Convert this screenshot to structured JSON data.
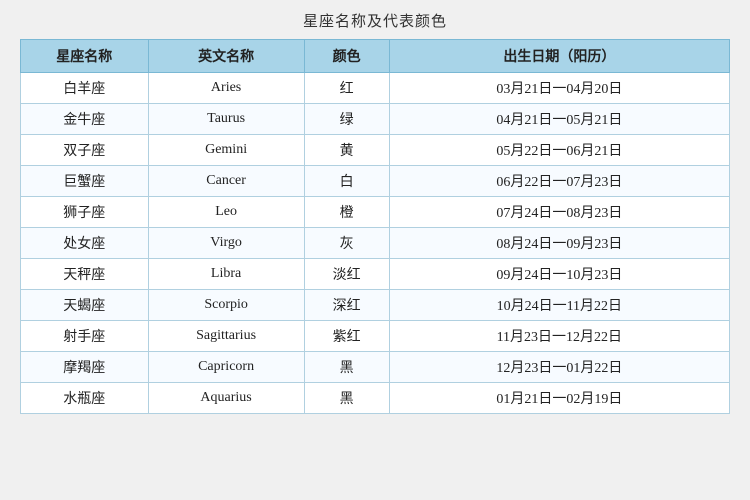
{
  "title": "星座名称及代表颜色",
  "headers": {
    "col1": "星座名称",
    "col2": "英文名称",
    "col3": "颜色",
    "col4": "出生日期（阳历）"
  },
  "rows": [
    {
      "chinese": "白羊座",
      "english": "Aries",
      "color": "红",
      "date": "03月21日一04月20日"
    },
    {
      "chinese": "金牛座",
      "english": "Taurus",
      "color": "绿",
      "date": "04月21日一05月21日"
    },
    {
      "chinese": "双子座",
      "english": "Gemini",
      "color": "黄",
      "date": "05月22日一06月21日"
    },
    {
      "chinese": "巨蟹座",
      "english": "Cancer",
      "color": "白",
      "date": "06月22日一07月23日"
    },
    {
      "chinese": "狮子座",
      "english": "Leo",
      "color": "橙",
      "date": "07月24日一08月23日"
    },
    {
      "chinese": "处女座",
      "english": "Virgo",
      "color": "灰",
      "date": "08月24日一09月23日"
    },
    {
      "chinese": "天秤座",
      "english": "Libra",
      "color": "淡红",
      "date": "09月24日一10月23日"
    },
    {
      "chinese": "天蝎座",
      "english": "Scorpio",
      "color": "深红",
      "date": "10月24日一11月22日"
    },
    {
      "chinese": "射手座",
      "english": "Sagittarius",
      "color": "紫红",
      "date": "11月23日一12月22日"
    },
    {
      "chinese": "摩羯座",
      "english": "Capricorn",
      "color": "黑",
      "date": "12月23日一01月22日"
    },
    {
      "chinese": "水瓶座",
      "english": "Aquarius",
      "color": "黑",
      "date": "01月21日一02月19日"
    }
  ]
}
